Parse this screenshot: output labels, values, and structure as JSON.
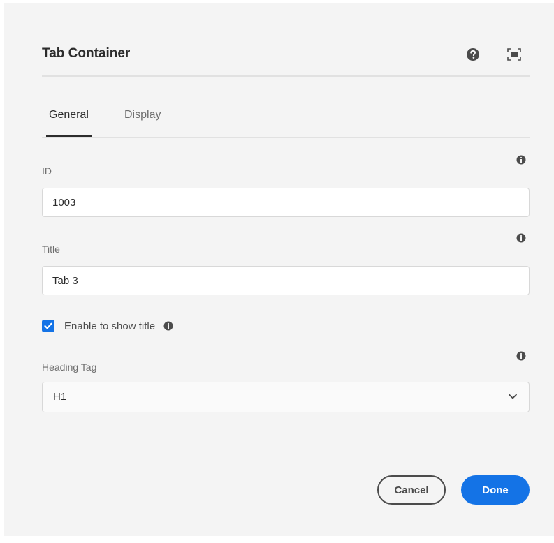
{
  "dialog": {
    "title": "Tab Container",
    "help_icon": "help-circle-icon",
    "fullscreen_icon": "fullscreen-icon"
  },
  "tabs": [
    {
      "label": "General",
      "selected": true
    },
    {
      "label": "Display",
      "selected": false
    }
  ],
  "fields": {
    "id": {
      "label": "ID",
      "value": "1003"
    },
    "title": {
      "label": "Title",
      "value": "Tab 3"
    },
    "show_title": {
      "label": "Enable to show title",
      "checked": true
    },
    "heading_tag": {
      "label": "Heading Tag",
      "value": "H1"
    }
  },
  "buttons": {
    "cancel": "Cancel",
    "done": "Done"
  },
  "colors": {
    "accent": "#1473e6",
    "background": "#f4f4f4",
    "text": "#2c2c2c"
  }
}
